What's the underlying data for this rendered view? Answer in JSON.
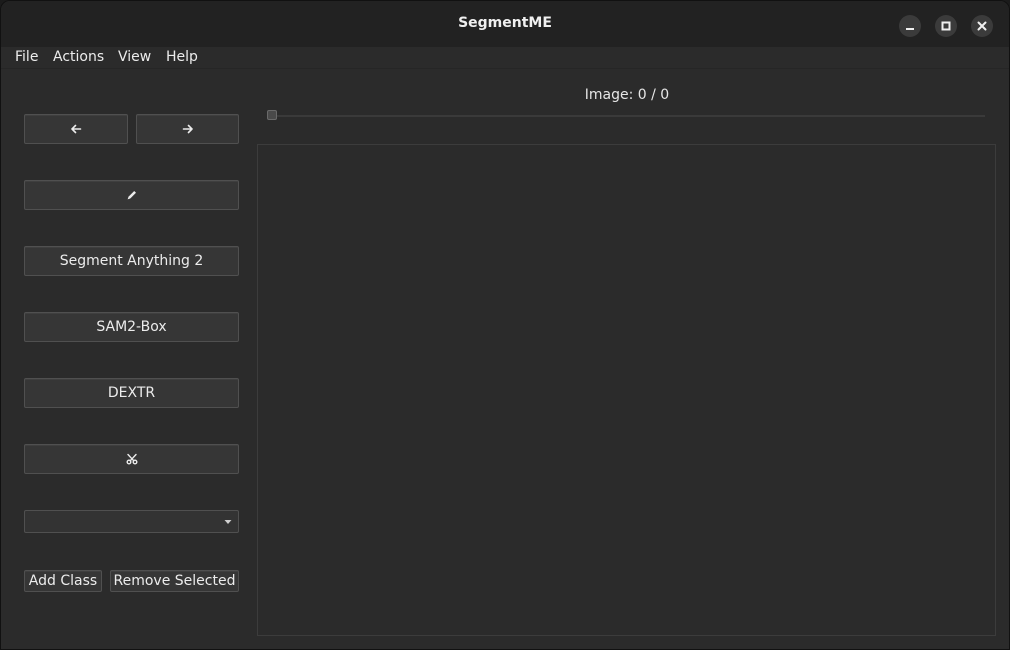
{
  "window": {
    "title": "SegmentME"
  },
  "menubar": {
    "items": [
      "File",
      "Actions",
      "View",
      "Help"
    ]
  },
  "toolbar": {
    "prev_icon": "arrow-left-icon",
    "next_icon": "arrow-right-icon",
    "draw_icon": "pencil-icon",
    "segment_anything_label": "Segment Anything 2",
    "sam2_box_label": "SAM2-Box",
    "dextr_label": "DEXTR",
    "cut_icon": "scissors-icon",
    "class_select_value": "",
    "add_class_label": "Add Class",
    "remove_selected_label": "Remove Selected"
  },
  "viewer": {
    "image_counter": "Image: 0 / 0",
    "slider_value": 0
  }
}
